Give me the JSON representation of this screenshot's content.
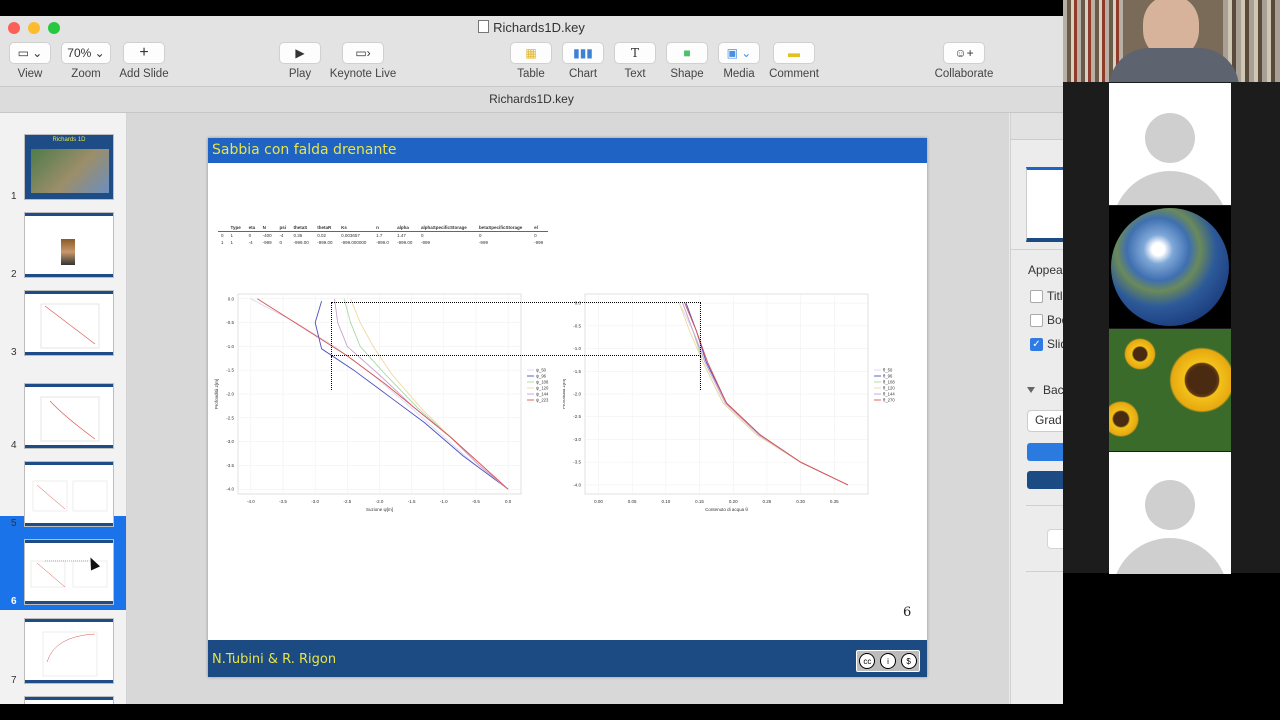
{
  "window": {
    "title": "Richards1D.key",
    "tab_title": "Richards1D.key"
  },
  "toolbar": {
    "view_label": "View",
    "zoom_value": "70%",
    "zoom_label": "Zoom",
    "add_slide_label": "Add Slide",
    "play_label": "Play",
    "keynote_live_label": "Keynote Live",
    "table_label": "Table",
    "chart_label": "Chart",
    "text_label": "Text",
    "shape_label": "Shape",
    "media_label": "Media",
    "comment_label": "Comment",
    "collaborate_label": "Collaborate"
  },
  "navigator": {
    "selected": 6,
    "slides": [
      {
        "num": "1",
        "label": "Richards 1D"
      },
      {
        "num": "2",
        "label": ""
      },
      {
        "num": "3",
        "label": ""
      },
      {
        "num": "4",
        "label": ""
      },
      {
        "num": "5",
        "label": ""
      },
      {
        "num": "6",
        "label": ""
      },
      {
        "num": "7",
        "label": ""
      }
    ]
  },
  "slide": {
    "title": "Sabbia con falda drenante",
    "authors": "N.Tubini  & R. Rigon",
    "page_number": "6",
    "params_table": {
      "headers": [
        "Type",
        "eta",
        "N",
        "psi",
        "thetaS",
        "thetaR",
        "Ks",
        "n",
        "alpha",
        "alphaSpecificStorage",
        "betaSpecificStorage",
        "el"
      ],
      "rows": [
        [
          "0",
          "1",
          "0",
          "-400",
          "-4",
          "0.36",
          "0.02",
          "0.003657",
          "1.7",
          "1.47",
          "0",
          "0",
          "0"
        ],
        [
          "1",
          "1",
          "-4",
          "-999",
          "0",
          "-999.00",
          "-999.00",
          "-999.000000",
          "-999.0",
          "-999.00",
          "-999",
          "-999",
          "-999"
        ]
      ]
    },
    "license_icons": [
      "cc-icon",
      "by-icon",
      "nc-icon"
    ]
  },
  "chart_data": [
    {
      "type": "line",
      "title": "",
      "xlabel": "Suzione ψ[m]",
      "ylabel": "Profondità z[m]",
      "xlim": [
        -4.2,
        0.2
      ],
      "ylim": [
        -4.1,
        0.1
      ],
      "xticks": [
        "-4.0",
        "-3.5",
        "-3.0",
        "-2.5",
        "-2.0",
        "-1.5",
        "-1.0",
        "-0.5",
        "0.0"
      ],
      "yticks": [
        "0.0",
        "-0.5",
        "-1.0",
        "-1.5",
        "-2.0",
        "-2.5",
        "-3.0",
        "-3.5",
        "-4.0"
      ],
      "legend": "right",
      "series": [
        {
          "name": "ψ_50",
          "color": "#d9d9f0",
          "points": [
            [
              -4.0,
              0.0
            ],
            [
              -3.3,
              -0.5
            ],
            [
              -2.7,
              -1.0
            ],
            [
              -2.1,
              -1.6
            ],
            [
              -1.5,
              -2.3
            ],
            [
              -1.0,
              -2.9
            ],
            [
              -0.5,
              -3.5
            ],
            [
              0.0,
              -4.0
            ]
          ]
        },
        {
          "name": "ψ_96",
          "color": "#4d4dbf",
          "points": [
            [
              -2.9,
              -0.05
            ],
            [
              -3.0,
              -0.5
            ],
            [
              -2.9,
              -1.05
            ],
            [
              -2.4,
              -1.5
            ],
            [
              -1.8,
              -2.1
            ],
            [
              -1.3,
              -2.6
            ],
            [
              -0.7,
              -3.3
            ],
            [
              0.0,
              -4.0
            ]
          ]
        },
        {
          "name": "ψ_108",
          "color": "#a8d8a8",
          "points": [
            [
              -2.55,
              0.0
            ],
            [
              -2.45,
              -0.5
            ],
            [
              -2.3,
              -1.0
            ],
            [
              -1.9,
              -1.6
            ],
            [
              -1.4,
              -2.3
            ],
            [
              -0.9,
              -2.9
            ],
            [
              -0.45,
              -3.5
            ],
            [
              0.0,
              -4.0
            ]
          ]
        },
        {
          "name": "ψ_120",
          "color": "#f0d9a0",
          "points": [
            [
              -2.45,
              0.0
            ],
            [
              -2.3,
              -0.5
            ],
            [
              -2.1,
              -1.0
            ],
            [
              -1.8,
              -1.6
            ],
            [
              -1.35,
              -2.3
            ],
            [
              -0.9,
              -2.9
            ],
            [
              -0.45,
              -3.5
            ],
            [
              0.0,
              -4.0
            ]
          ]
        },
        {
          "name": "ψ_144",
          "color": "#c9a0d6",
          "points": [
            [
              -2.7,
              0.0
            ],
            [
              -2.65,
              -0.5
            ],
            [
              -2.5,
              -1.0
            ],
            [
              -2.0,
              -1.6
            ],
            [
              -1.45,
              -2.3
            ],
            [
              -0.9,
              -2.9
            ],
            [
              -0.45,
              -3.5
            ],
            [
              0.0,
              -4.0
            ]
          ]
        },
        {
          "name": "ψ_223",
          "color": "#d9534f",
          "points": [
            [
              -3.9,
              0.0
            ],
            [
              -3.2,
              -0.6
            ],
            [
              -2.5,
              -1.2
            ],
            [
              -1.9,
              -1.8
            ],
            [
              -1.4,
              -2.35
            ],
            [
              -0.9,
              -2.9
            ],
            [
              -0.45,
              -3.45
            ],
            [
              0.0,
              -4.0
            ]
          ]
        }
      ]
    },
    {
      "type": "line",
      "title": "",
      "xlabel": "Contenuto di acqua θ",
      "ylabel": "Profondità z[m]",
      "xlim": [
        -0.02,
        0.4
      ],
      "ylim": [
        -4.2,
        0.2
      ],
      "xticks": [
        "0.00",
        "0.05",
        "0.10",
        "0.15",
        "0.20",
        "0.25",
        "0.30",
        "0.35"
      ],
      "yticks": [
        "0.0",
        "-0.5",
        "-1.0",
        "-1.5",
        "-2.0",
        "-2.5",
        "-3.0",
        "-3.5",
        "-4.0"
      ],
      "legend": "right",
      "series": [
        {
          "name": "θ_50",
          "color": "#d9d9f0",
          "points": [
            [
              0.12,
              0.0
            ],
            [
              0.14,
              -0.6
            ],
            [
              0.16,
              -1.3
            ],
            [
              0.19,
              -2.2
            ],
            [
              0.24,
              -2.9
            ],
            [
              0.3,
              -3.5
            ],
            [
              0.37,
              -4.0
            ]
          ]
        },
        {
          "name": "θ_96",
          "color": "#4d4dbf",
          "points": [
            [
              0.13,
              0.0
            ],
            [
              0.145,
              -0.6
            ],
            [
              0.16,
              -1.3
            ],
            [
              0.19,
              -2.2
            ],
            [
              0.24,
              -2.9
            ],
            [
              0.3,
              -3.5
            ],
            [
              0.37,
              -4.0
            ]
          ]
        },
        {
          "name": "θ_108",
          "color": "#a8d8a8",
          "points": [
            [
              0.125,
              0.0
            ],
            [
              0.14,
              -0.6
            ],
            [
              0.155,
              -1.3
            ],
            [
              0.185,
              -2.2
            ],
            [
              0.235,
              -2.9
            ],
            [
              0.3,
              -3.5
            ],
            [
              0.37,
              -4.0
            ]
          ]
        },
        {
          "name": "θ_120",
          "color": "#f0d9a0",
          "points": [
            [
              0.12,
              0.0
            ],
            [
              0.135,
              -0.6
            ],
            [
              0.155,
              -1.3
            ],
            [
              0.185,
              -2.2
            ],
            [
              0.235,
              -2.9
            ],
            [
              0.3,
              -3.5
            ],
            [
              0.37,
              -4.0
            ]
          ]
        },
        {
          "name": "θ_144",
          "color": "#c9a0d6",
          "points": [
            [
              0.125,
              0.0
            ],
            [
              0.14,
              -0.6
            ],
            [
              0.158,
              -1.3
            ],
            [
              0.188,
              -2.2
            ],
            [
              0.238,
              -2.9
            ],
            [
              0.3,
              -3.5
            ],
            [
              0.37,
              -4.0
            ]
          ]
        },
        {
          "name": "θ_270",
          "color": "#d9534f",
          "points": [
            [
              0.128,
              0.0
            ],
            [
              0.145,
              -0.6
            ],
            [
              0.162,
              -1.3
            ],
            [
              0.19,
              -2.2
            ],
            [
              0.24,
              -2.9
            ],
            [
              0.3,
              -3.5
            ],
            [
              0.37,
              -4.0
            ]
          ]
        }
      ]
    }
  ],
  "inspector": {
    "appearance_label": "Appea",
    "title_label": "Titl",
    "body_label": "Bod",
    "slide_number_label": "Slid",
    "background_label": "Bac",
    "fill_type": "Grad"
  },
  "colors": {
    "slide_header": "#1f63c4",
    "slide_footer": "#1b4b82",
    "title_text": "#e8e44a",
    "selection": "#1a73e8"
  }
}
